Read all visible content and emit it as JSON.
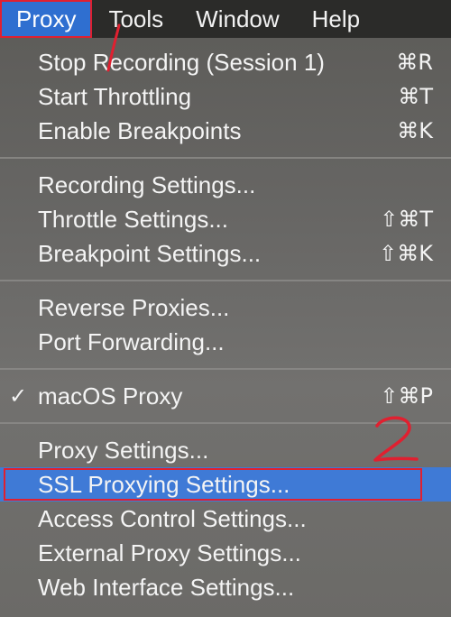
{
  "menubar": {
    "items": [
      {
        "label": "Proxy"
      },
      {
        "label": "Tools"
      },
      {
        "label": "Window"
      },
      {
        "label": "Help"
      }
    ]
  },
  "menu": {
    "groups": [
      {
        "items": [
          {
            "label": "Stop Recording (Session 1)",
            "shortcut": "⌘R"
          },
          {
            "label": "Start Throttling",
            "shortcut": "⌘T"
          },
          {
            "label": "Enable Breakpoints",
            "shortcut": "⌘K"
          }
        ]
      },
      {
        "items": [
          {
            "label": "Recording Settings...",
            "shortcut": ""
          },
          {
            "label": "Throttle Settings...",
            "shortcut": "⇧⌘T"
          },
          {
            "label": "Breakpoint Settings...",
            "shortcut": "⇧⌘K"
          }
        ]
      },
      {
        "items": [
          {
            "label": "Reverse Proxies...",
            "shortcut": ""
          },
          {
            "label": "Port Forwarding...",
            "shortcut": ""
          }
        ]
      },
      {
        "items": [
          {
            "label": "macOS Proxy",
            "shortcut": "⇧⌘P",
            "check": "✓"
          }
        ]
      },
      {
        "items": [
          {
            "label": "Proxy Settings...",
            "shortcut": ""
          },
          {
            "label": "SSL Proxying Settings...",
            "shortcut": ""
          },
          {
            "label": "Access Control Settings...",
            "shortcut": ""
          },
          {
            "label": "External Proxy Settings...",
            "shortcut": ""
          },
          {
            "label": "Web Interface Settings...",
            "shortcut": ""
          }
        ]
      }
    ]
  },
  "annotations": {
    "color": "#e02030",
    "step1": "1",
    "step2": "2"
  },
  "colors": {
    "highlight": "#3f7ad6",
    "menubar_active": "#2f6fd0"
  }
}
